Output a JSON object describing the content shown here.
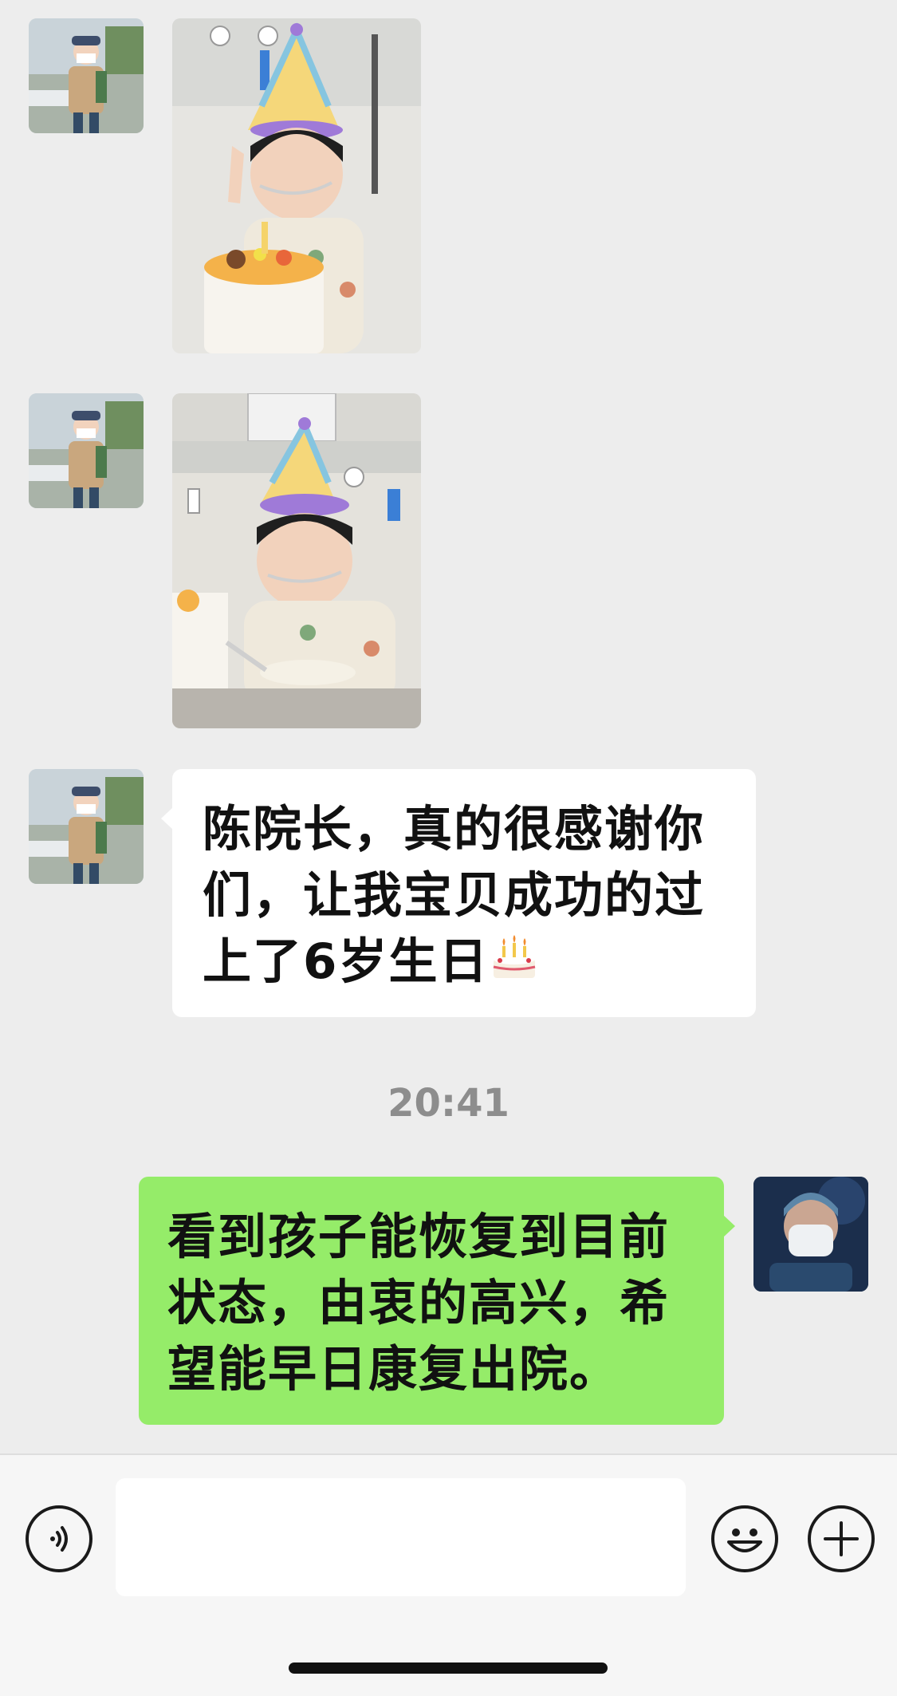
{
  "chat": {
    "messages": [
      {
        "type": "image",
        "sender": "patient-parent",
        "alt": "child with birthday hat and cake"
      },
      {
        "type": "image",
        "sender": "patient-parent",
        "alt": "child eating birthday cake"
      },
      {
        "type": "text",
        "sender": "patient-parent",
        "text": "陈院长，真的很感谢你们，让我宝贝成功的过上了6岁生日",
        "emoji": "🎂"
      },
      {
        "type": "text",
        "sender": "doctor",
        "text": "看到孩子能恢复到目前状态，由衷的高兴，希望能早日康复出院。"
      }
    ],
    "timestamp": "20:41"
  },
  "input_bar": {
    "voice_icon": "voice-icon",
    "emoji_icon": "emoji-icon",
    "add_icon": "plus-icon",
    "placeholder": ""
  },
  "colors": {
    "background": "#ededed",
    "outgoing_bubble": "#95ec69",
    "incoming_bubble": "#ffffff",
    "timestamp_text": "#8d8d8d"
  }
}
